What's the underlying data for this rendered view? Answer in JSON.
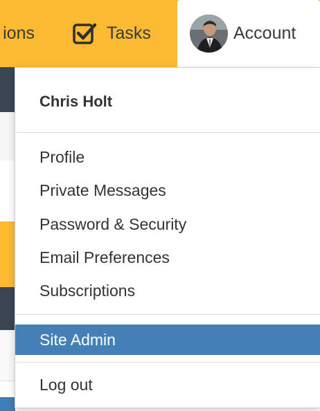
{
  "nav": {
    "partial_label": "ions",
    "tasks_label": "Tasks",
    "account_label": "Account",
    "check_icon": "checkbox-checked-icon",
    "avatar": "user-avatar"
  },
  "dropdown": {
    "user_name": "Chris Holt",
    "items": [
      {
        "label": "Profile"
      },
      {
        "label": "Private Messages"
      },
      {
        "label": "Password & Security"
      },
      {
        "label": "Email Preferences"
      },
      {
        "label": "Subscriptions"
      }
    ],
    "admin_label": "Site Admin",
    "logout_label": "Log out"
  },
  "colors": {
    "navbar": "#fbba32",
    "active": "#4480b6",
    "dark_panel": "#3a4654"
  }
}
